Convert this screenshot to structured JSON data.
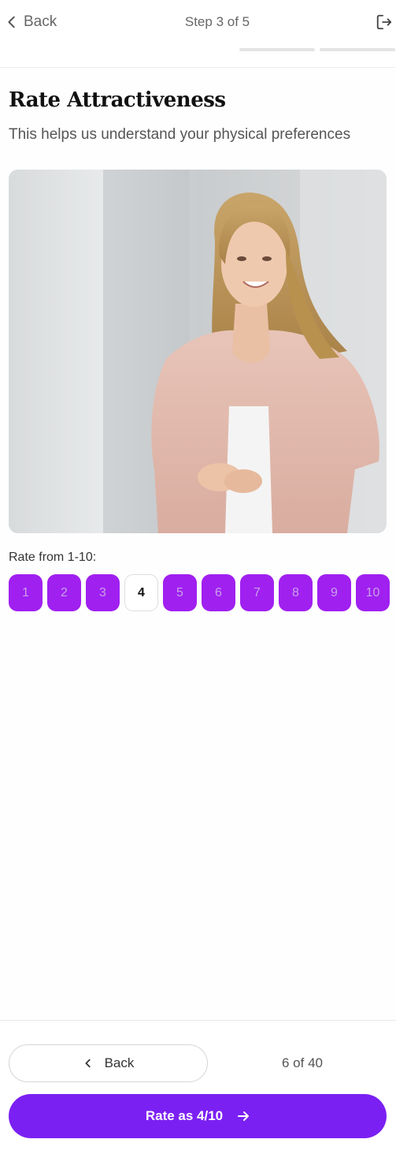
{
  "header": {
    "back_label": "Back",
    "step_label": "Step 3 of 5",
    "progress_segments": 2
  },
  "main": {
    "title": "Rate Attractiveness",
    "subtitle": "This helps us understand your physical preferences",
    "photo_icon": "portrait-photo",
    "rating_label": "Rate from 1-10:",
    "rating_options": [
      "1",
      "2",
      "3",
      "4",
      "5",
      "6",
      "7",
      "8",
      "9",
      "10"
    ],
    "selected_rating": "4"
  },
  "footer": {
    "back_label": "Back",
    "counter": "6 of 40",
    "submit_label": "Rate as 4/10"
  },
  "colors": {
    "accent": "#7b20f2",
    "rating_button": "#a020f0"
  }
}
